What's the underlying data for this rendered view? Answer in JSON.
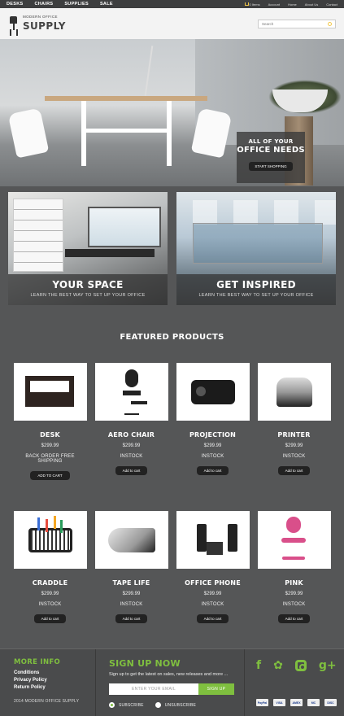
{
  "topnav": {
    "categories": [
      "DESKS",
      "CHAIRS",
      "SUPPLIES",
      "SALE"
    ],
    "cart_count": "0 Items",
    "account": "Account",
    "home": "Home",
    "about": "About Us",
    "contact": "Contact"
  },
  "header": {
    "logo_small": "MODERN OFFICE",
    "logo_big": "SUPPLY",
    "search_placeholder": "Search"
  },
  "hero": {
    "line1": "ALL OF YOUR",
    "line2": "OFFICE NEEDS",
    "cta": "START SHOPPING"
  },
  "promos": [
    {
      "title": "YOUR SPACE",
      "subtitle": "LEARN THE BEST WAY TO SET UP YOUR OFFICE"
    },
    {
      "title": "GET INSPIRED",
      "subtitle": "LEARN THE BEST WAY TO SET UP YOUR OFFICE"
    }
  ],
  "featured": {
    "title": "FEATURED PRODUCTS",
    "products": [
      {
        "name": "DESK",
        "price": "$299.99",
        "stock": "BACK ORDER FREE SHIPPING",
        "button": "ADD TO CART"
      },
      {
        "name": "AERO CHAIR",
        "price": "$299.99",
        "stock": "INSTOCK",
        "button": "Add to cart"
      },
      {
        "name": "PROJECTION",
        "price": "$299.99",
        "stock": "INSTOCK",
        "button": "Add to cart"
      },
      {
        "name": "PRINTER",
        "price": "$299.99",
        "stock": "INSTOCK",
        "button": "Add to cart"
      },
      {
        "name": "CRADDLE",
        "price": "$299.99",
        "stock": "INSTOCK",
        "button": "Add to cart"
      },
      {
        "name": "TAPE LIFE",
        "price": "$299.99",
        "stock": "INSTOCK",
        "button": "Add to cart"
      },
      {
        "name": "OFFICE PHONE",
        "price": "$299.99",
        "stock": "INSTOCK",
        "button": "Add to cart"
      },
      {
        "name": "PINK",
        "price": "$299.99",
        "stock": "INSTOCK",
        "button": "Add to cart"
      }
    ]
  },
  "footer": {
    "more_info": "MORE INFO",
    "links": [
      "Conditions",
      "Privacy Policy",
      "Return Policy"
    ],
    "copyright": "2014 MODERN OFFICE SUPPLY",
    "signup_title": "SIGN UP NOW",
    "signup_text": "Sign up to get the latest on sales, new releases and more ...",
    "email_placeholder": "ENTER YOUR EMAIL",
    "signup_button": "SIGN UP",
    "subscribe": "SUBSCRIBE",
    "unsubscribe": "UNSUBSCRIBE",
    "social_icons": [
      "facebook-icon",
      "twitter-icon",
      "instagram-icon",
      "google-plus-icon"
    ],
    "payment_icons": [
      "PayPal",
      "VISA",
      "AMEX",
      "MC",
      "DISC"
    ]
  },
  "colors": {
    "accent": "#7fbf3f",
    "background": "#555657",
    "header": "#f3f3f3"
  }
}
